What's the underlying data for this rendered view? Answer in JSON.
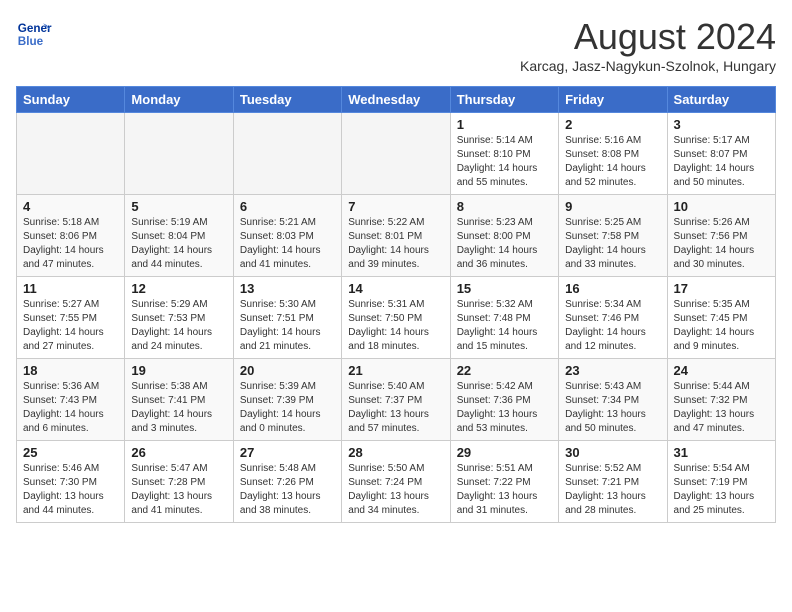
{
  "header": {
    "logo_line1": "General",
    "logo_line2": "Blue",
    "title": "August 2024",
    "subtitle": "Karcag, Jasz-Nagykun-Szolnok, Hungary"
  },
  "weekdays": [
    "Sunday",
    "Monday",
    "Tuesday",
    "Wednesday",
    "Thursday",
    "Friday",
    "Saturday"
  ],
  "weeks": [
    [
      {
        "day": "",
        "info": ""
      },
      {
        "day": "",
        "info": ""
      },
      {
        "day": "",
        "info": ""
      },
      {
        "day": "",
        "info": ""
      },
      {
        "day": "1",
        "info": "Sunrise: 5:14 AM\nSunset: 8:10 PM\nDaylight: 14 hours\nand 55 minutes."
      },
      {
        "day": "2",
        "info": "Sunrise: 5:16 AM\nSunset: 8:08 PM\nDaylight: 14 hours\nand 52 minutes."
      },
      {
        "day": "3",
        "info": "Sunrise: 5:17 AM\nSunset: 8:07 PM\nDaylight: 14 hours\nand 50 minutes."
      }
    ],
    [
      {
        "day": "4",
        "info": "Sunrise: 5:18 AM\nSunset: 8:06 PM\nDaylight: 14 hours\nand 47 minutes."
      },
      {
        "day": "5",
        "info": "Sunrise: 5:19 AM\nSunset: 8:04 PM\nDaylight: 14 hours\nand 44 minutes."
      },
      {
        "day": "6",
        "info": "Sunrise: 5:21 AM\nSunset: 8:03 PM\nDaylight: 14 hours\nand 41 minutes."
      },
      {
        "day": "7",
        "info": "Sunrise: 5:22 AM\nSunset: 8:01 PM\nDaylight: 14 hours\nand 39 minutes."
      },
      {
        "day": "8",
        "info": "Sunrise: 5:23 AM\nSunset: 8:00 PM\nDaylight: 14 hours\nand 36 minutes."
      },
      {
        "day": "9",
        "info": "Sunrise: 5:25 AM\nSunset: 7:58 PM\nDaylight: 14 hours\nand 33 minutes."
      },
      {
        "day": "10",
        "info": "Sunrise: 5:26 AM\nSunset: 7:56 PM\nDaylight: 14 hours\nand 30 minutes."
      }
    ],
    [
      {
        "day": "11",
        "info": "Sunrise: 5:27 AM\nSunset: 7:55 PM\nDaylight: 14 hours\nand 27 minutes."
      },
      {
        "day": "12",
        "info": "Sunrise: 5:29 AM\nSunset: 7:53 PM\nDaylight: 14 hours\nand 24 minutes."
      },
      {
        "day": "13",
        "info": "Sunrise: 5:30 AM\nSunset: 7:51 PM\nDaylight: 14 hours\nand 21 minutes."
      },
      {
        "day": "14",
        "info": "Sunrise: 5:31 AM\nSunset: 7:50 PM\nDaylight: 14 hours\nand 18 minutes."
      },
      {
        "day": "15",
        "info": "Sunrise: 5:32 AM\nSunset: 7:48 PM\nDaylight: 14 hours\nand 15 minutes."
      },
      {
        "day": "16",
        "info": "Sunrise: 5:34 AM\nSunset: 7:46 PM\nDaylight: 14 hours\nand 12 minutes."
      },
      {
        "day": "17",
        "info": "Sunrise: 5:35 AM\nSunset: 7:45 PM\nDaylight: 14 hours\nand 9 minutes."
      }
    ],
    [
      {
        "day": "18",
        "info": "Sunrise: 5:36 AM\nSunset: 7:43 PM\nDaylight: 14 hours\nand 6 minutes."
      },
      {
        "day": "19",
        "info": "Sunrise: 5:38 AM\nSunset: 7:41 PM\nDaylight: 14 hours\nand 3 minutes."
      },
      {
        "day": "20",
        "info": "Sunrise: 5:39 AM\nSunset: 7:39 PM\nDaylight: 14 hours\nand 0 minutes."
      },
      {
        "day": "21",
        "info": "Sunrise: 5:40 AM\nSunset: 7:37 PM\nDaylight: 13 hours\nand 57 minutes."
      },
      {
        "day": "22",
        "info": "Sunrise: 5:42 AM\nSunset: 7:36 PM\nDaylight: 13 hours\nand 53 minutes."
      },
      {
        "day": "23",
        "info": "Sunrise: 5:43 AM\nSunset: 7:34 PM\nDaylight: 13 hours\nand 50 minutes."
      },
      {
        "day": "24",
        "info": "Sunrise: 5:44 AM\nSunset: 7:32 PM\nDaylight: 13 hours\nand 47 minutes."
      }
    ],
    [
      {
        "day": "25",
        "info": "Sunrise: 5:46 AM\nSunset: 7:30 PM\nDaylight: 13 hours\nand 44 minutes."
      },
      {
        "day": "26",
        "info": "Sunrise: 5:47 AM\nSunset: 7:28 PM\nDaylight: 13 hours\nand 41 minutes."
      },
      {
        "day": "27",
        "info": "Sunrise: 5:48 AM\nSunset: 7:26 PM\nDaylight: 13 hours\nand 38 minutes."
      },
      {
        "day": "28",
        "info": "Sunrise: 5:50 AM\nSunset: 7:24 PM\nDaylight: 13 hours\nand 34 minutes."
      },
      {
        "day": "29",
        "info": "Sunrise: 5:51 AM\nSunset: 7:22 PM\nDaylight: 13 hours\nand 31 minutes."
      },
      {
        "day": "30",
        "info": "Sunrise: 5:52 AM\nSunset: 7:21 PM\nDaylight: 13 hours\nand 28 minutes."
      },
      {
        "day": "31",
        "info": "Sunrise: 5:54 AM\nSunset: 7:19 PM\nDaylight: 13 hours\nand 25 minutes."
      }
    ]
  ]
}
